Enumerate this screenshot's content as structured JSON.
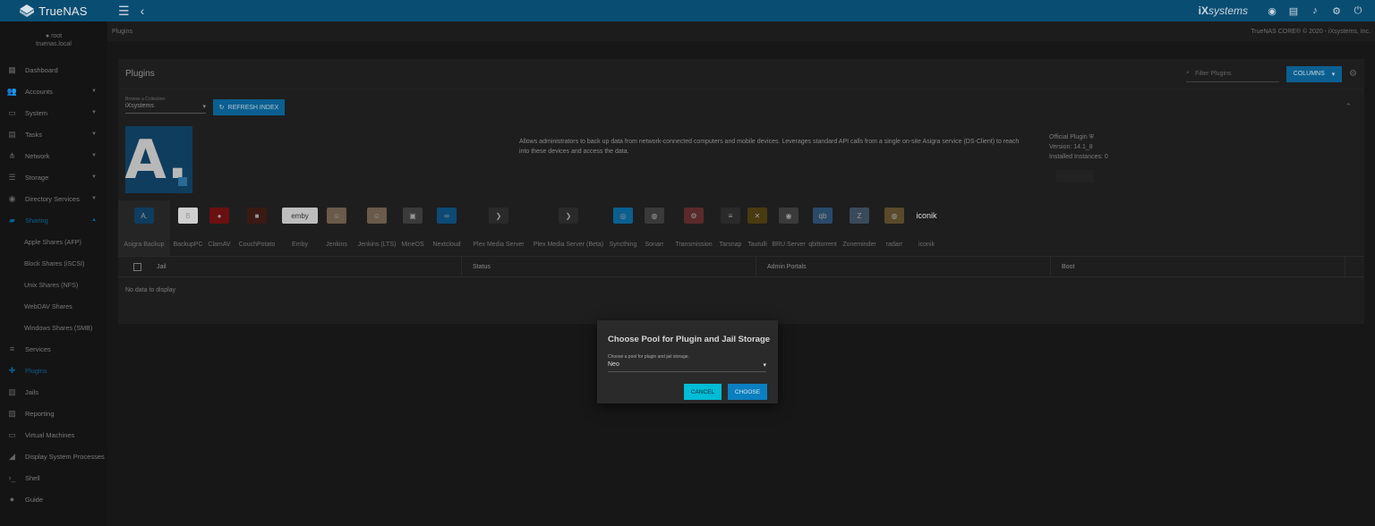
{
  "topbar": {
    "brand_name": "TrueNAS",
    "vendor_logo_prefix": "iX",
    "vendor_logo_suffix": "systems",
    "icons": [
      "truecommand-icon",
      "clipboard-icon",
      "bell-icon",
      "gear-icon",
      "power-icon"
    ]
  },
  "sidebar": {
    "user": "root",
    "host": "truenas.local",
    "items": [
      {
        "label": "Dashboard",
        "icon": "dashboard-icon",
        "caret": false
      },
      {
        "label": "Accounts",
        "icon": "people-icon",
        "caret": true
      },
      {
        "label": "System",
        "icon": "laptop-icon",
        "caret": true
      },
      {
        "label": "Tasks",
        "icon": "calendar-icon",
        "caret": true
      },
      {
        "label": "Network",
        "icon": "network-icon",
        "caret": true
      },
      {
        "label": "Storage",
        "icon": "storage-icon",
        "caret": true
      },
      {
        "label": "Directory Services",
        "icon": "directory-icon",
        "caret": true
      },
      {
        "label": "Sharing",
        "icon": "folder-share-icon",
        "caret": true,
        "active": true
      }
    ],
    "sub_items": [
      "Apple Shares (AFP)",
      "Block Shares (iSCSI)",
      "Unix Shares (NFS)",
      "WebDAV Shares",
      "Windows Shares (SMB)"
    ],
    "items_after": [
      {
        "label": "Services",
        "icon": "tune-icon"
      },
      {
        "label": "Plugins",
        "icon": "puzzle-icon",
        "active": true
      },
      {
        "label": "Jails",
        "icon": "jail-icon"
      },
      {
        "label": "Reporting",
        "icon": "chart-icon"
      },
      {
        "label": "Virtual Machines",
        "icon": "computer-icon"
      },
      {
        "label": "Display System Processes",
        "icon": "processes-icon"
      },
      {
        "label": "Shell",
        "icon": "terminal-icon"
      },
      {
        "label": "Guide",
        "icon": "info-icon"
      }
    ]
  },
  "breadcrumb": {
    "current": "Plugins",
    "copyright": "TrueNAS CORE® © 2020 - iXsystems, Inc."
  },
  "card": {
    "title": "Plugins",
    "filter_placeholder": "Filter Plugins",
    "columns_label": "COLUMNS",
    "collection_label": "Browse a Collection",
    "collection_value": "iXsystems",
    "refresh_label": "REFRESH INDEX",
    "selected_plugin": {
      "logo_letter": "A.",
      "description": "Allows administrators to back up data from network-connected computers and mobile devices. Leverages standard API calls from a single on-site Asigra service (DS-Client) to reach into these devices and access the data.",
      "official_label": "Official Plugin",
      "version": "Version: 14.1_8",
      "instances": "Installed Instances: 0"
    },
    "plugins": [
      {
        "name": "Asigra Backup",
        "icon": "asigra-icon",
        "glyph": "A.",
        "color": "#0f3d5e",
        "w": 58
      },
      {
        "name": "BackupPC",
        "icon": "backuppc-icon",
        "glyph": "B",
        "color": "#cfcfcf",
        "w": 40
      },
      {
        "name": "ClamAV",
        "icon": "clamav-icon",
        "glyph": "●",
        "color": "#6a1010",
        "w": 30
      },
      {
        "name": "CouchPotato",
        "icon": "couchpotato-icon",
        "glyph": "■",
        "color": "#3a1a12",
        "w": 54
      },
      {
        "name": "Emby",
        "icon": "emby-icon",
        "glyph": "emby",
        "color": "#bdbdbd",
        "w": 42
      },
      {
        "name": "Jenkins",
        "icon": "jenkins-icon",
        "glyph": "☺",
        "color": "#6a5a4a",
        "w": 40
      },
      {
        "name": "Jenkins (LTS)",
        "icon": "jenkins-lts-icon",
        "glyph": "☺",
        "color": "#6a5a4a",
        "w": 50
      },
      {
        "name": "MineOS",
        "icon": "mineos-icon",
        "glyph": "▣",
        "color": "#3b3b3b",
        "w": 30
      },
      {
        "name": "Nextcloud",
        "icon": "nextcloud-icon",
        "glyph": "∞",
        "color": "#0c4a75",
        "w": 46
      },
      {
        "name": "Plex Media Server",
        "icon": "plex-icon",
        "glyph": "❯",
        "color": "#2a2a2a",
        "w": 70
      },
      {
        "name": "Plex Media Server (Beta)",
        "icon": "plex-beta-icon",
        "glyph": "❯",
        "color": "#2a2a2a",
        "w": 86
      },
      {
        "name": "Syncthing",
        "icon": "syncthing-icon",
        "glyph": "◎",
        "color": "#0b5f90",
        "w": 36
      },
      {
        "name": "Sonarr",
        "icon": "sonarr-icon",
        "glyph": "◍",
        "color": "#3a3a3a",
        "w": 34
      },
      {
        "name": "Transmission",
        "icon": "transmission-icon",
        "glyph": "⚙",
        "color": "#5a2a2a",
        "w": 54
      },
      {
        "name": "Tarsnap",
        "icon": "tarsnap-icon",
        "glyph": "≡",
        "color": "#2a2a2a",
        "w": 28
      },
      {
        "name": "Tautulli",
        "icon": "tautulli-icon",
        "glyph": "✕",
        "color": "#4a3a10",
        "w": 32
      },
      {
        "name": "BRU Server",
        "icon": "bru-server-icon",
        "glyph": "◉",
        "color": "#3a3a3a",
        "w": 38
      },
      {
        "name": "qbittorrent",
        "icon": "qbittorrent-icon",
        "glyph": "qb",
        "color": "#2a4a6a",
        "w": 38
      },
      {
        "name": "Zoneminder",
        "icon": "zoneminder-icon",
        "glyph": "Z",
        "color": "#3a4a5a",
        "w": 44
      },
      {
        "name": "radarr",
        "icon": "radarr-icon",
        "glyph": "◍",
        "color": "#5a4a2a",
        "w": 34
      },
      {
        "name": "iconik",
        "icon": "iconik-icon",
        "glyph": "iconik",
        "color": "#1e1e1e",
        "w": 38
      }
    ],
    "table_headers": [
      "Jail",
      "Status",
      "Admin Portals",
      "Boot"
    ],
    "empty_text": "No data to display"
  },
  "dialog": {
    "title": "Choose Pool for Plugin and Jail Storage",
    "select_label": "Choose a pool for plugin and jail storage.",
    "select_value": "Neo",
    "cancel_label": "CANCEL",
    "choose_label": "CHOOSE"
  }
}
